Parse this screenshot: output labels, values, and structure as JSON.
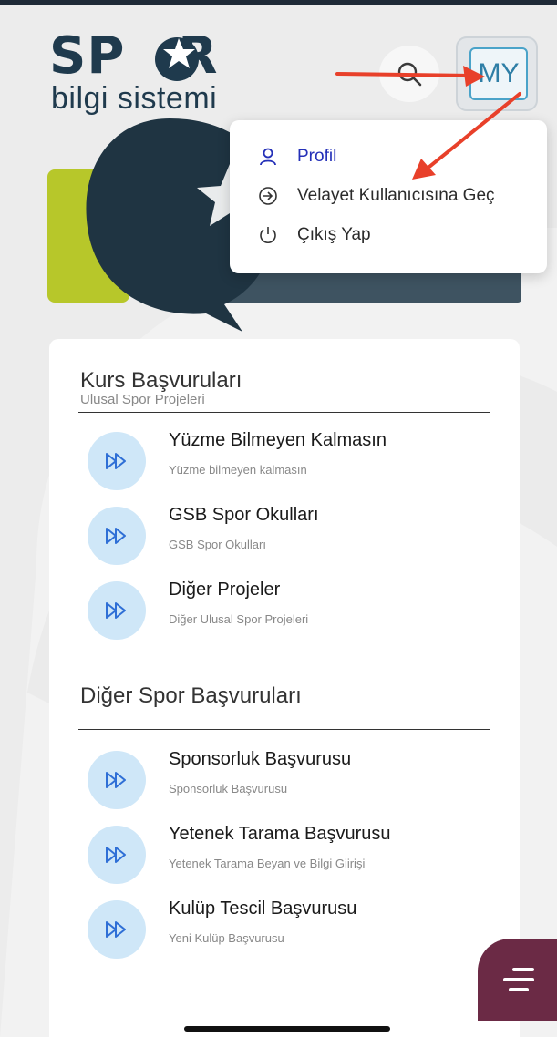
{
  "logo": {
    "brand": "SP",
    "brand_end": "R",
    "subtitle": "bilgi sistemi"
  },
  "header": {
    "search_icon": "search-icon",
    "avatar_initials": "MY"
  },
  "user_menu": {
    "items": [
      {
        "label": "Profil",
        "icon": "user-icon",
        "active": true
      },
      {
        "label": "Velayet Kullanıcısına Geç",
        "icon": "arrow-circle-right-icon",
        "active": false
      },
      {
        "label": "Çıkış Yap",
        "icon": "power-icon",
        "active": false
      }
    ]
  },
  "sections": [
    {
      "title": "Kurs Başvuruları",
      "subtitle": "Ulusal Spor Projeleri",
      "items": [
        {
          "title": "Yüzme Bilmeyen Kalmasın",
          "subtitle": "Yüzme bilmeyen kalmasın",
          "icon": "fast-forward-icon"
        },
        {
          "title": "GSB Spor Okulları",
          "subtitle": "GSB Spor Okulları",
          "icon": "fast-forward-icon"
        },
        {
          "title": "Diğer Projeler",
          "subtitle": "Diğer Ulusal Spor Projeleri",
          "icon": "fast-forward-icon"
        }
      ]
    },
    {
      "title": "Diğer Spor Başvuruları",
      "subtitle": "",
      "items": [
        {
          "title": "Sponsorluk Başvurusu",
          "subtitle": "Sponsorluk Başvurusu",
          "icon": "fast-forward-icon"
        },
        {
          "title": "Yetenek Tarama Başvurusu",
          "subtitle": "Yetenek Tarama Beyan ve Bilgi Giirişi",
          "icon": "fast-forward-icon"
        },
        {
          "title": "Kulüp Tescil Başvurusu",
          "subtitle": "Yeni Kulüp Başvurusu",
          "icon": "fast-forward-icon"
        }
      ]
    }
  ],
  "fab": {
    "icon": "menu-lines-icon"
  },
  "colors": {
    "brand_navy": "#1f3a4d",
    "accent_green": "#b7c72a",
    "menu_active": "#2430b8",
    "item_icon_bg": "#cfe7f8",
    "fab_bg": "#6b2a45",
    "annotation_arrow": "#e8402a"
  }
}
